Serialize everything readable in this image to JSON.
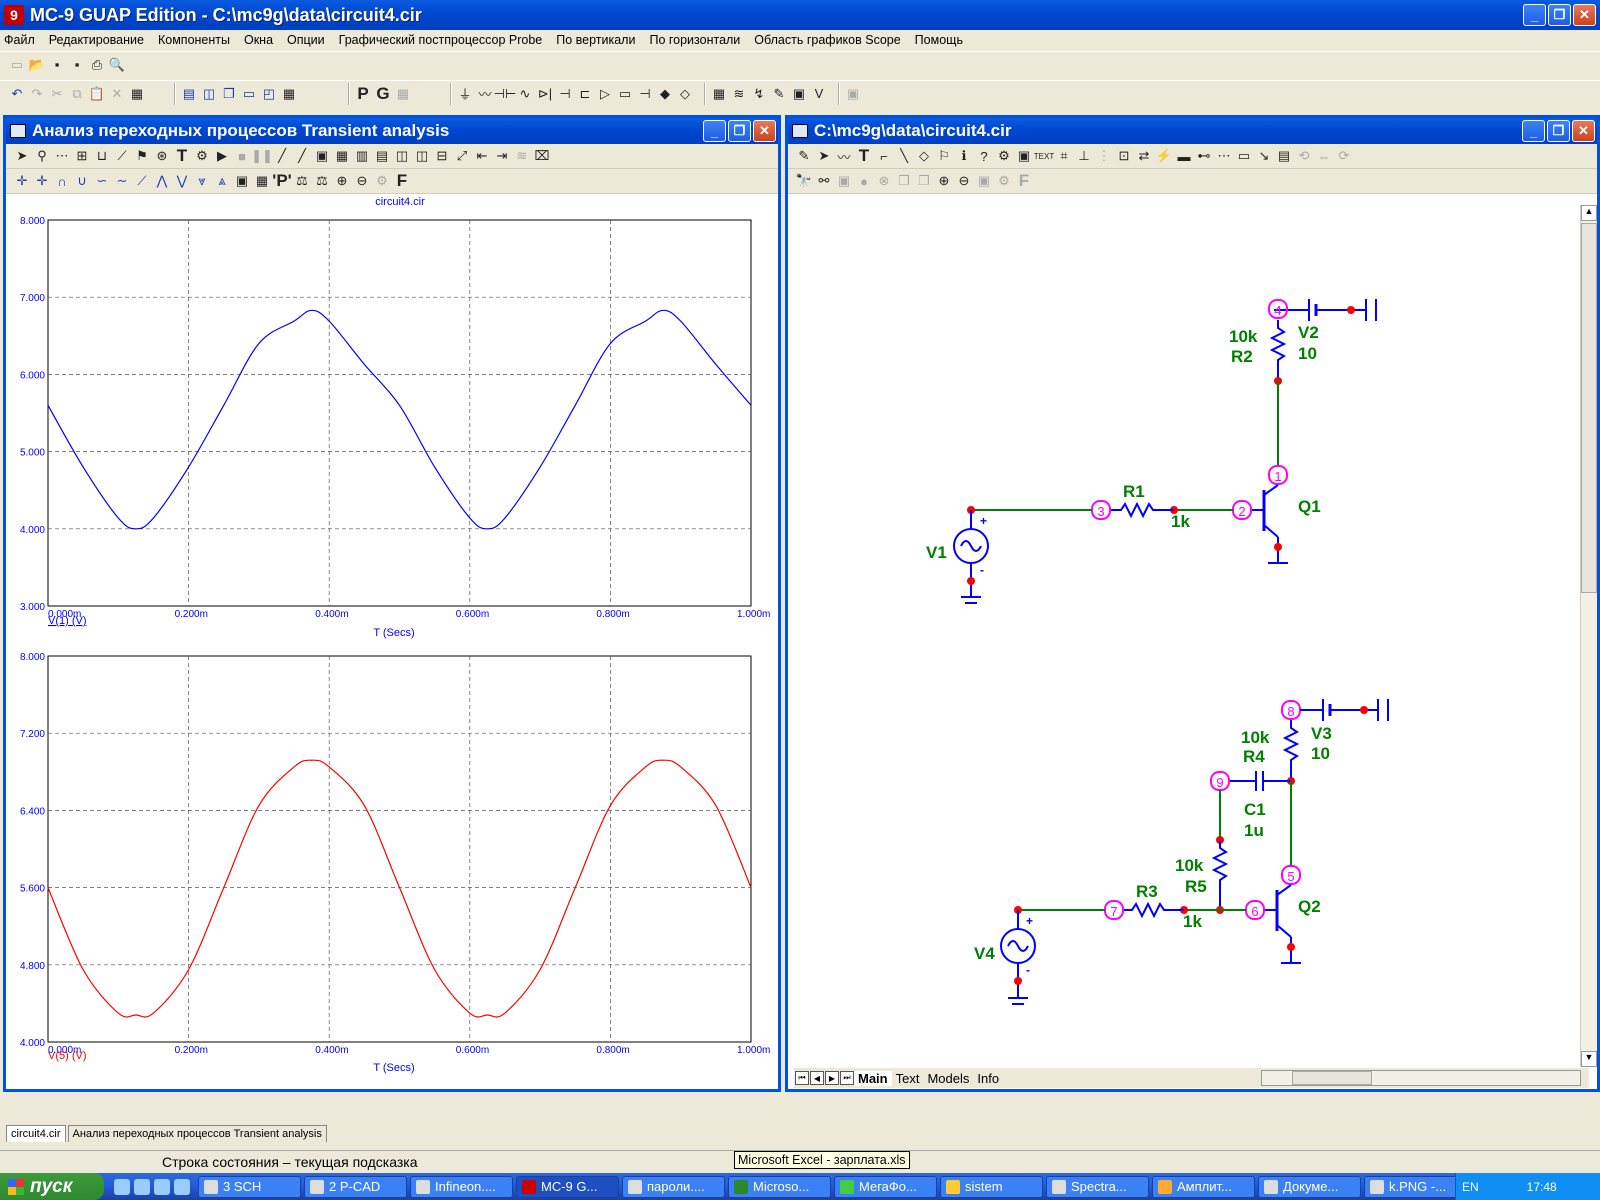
{
  "window": {
    "title": "MC-9 GUAP Edition - C:\\mc9g\\data\\circuit4.cir",
    "app_icon_glyph": "9",
    "minimize": "_",
    "maximize": "❐",
    "close": "✕"
  },
  "menu": [
    "Файл",
    "Редактирование",
    "Компоненты",
    "Окна",
    "Опции",
    "Графический постпроцессор Probe",
    "По вертикали",
    "По горизонтали",
    "Область графиков Scope",
    "Помощь"
  ],
  "transient_window": {
    "title": "Анализ переходных процессов Transient analysis"
  },
  "plot1": {
    "title": "circuit4.cir",
    "trace_label": "V(1) (V)",
    "x_axis_title": "T (Secs)",
    "color": "#0000ff"
  },
  "plot2": {
    "trace_label": "V(5) (V)",
    "x_axis_title": "T (Secs)",
    "color": "#ff0000"
  },
  "chart_data": [
    {
      "type": "line",
      "title": "circuit4.cir",
      "xlabel": "T (Secs)",
      "ylabel": "",
      "xlim": [
        0,
        1.0
      ],
      "ylim": [
        3.0,
        8.0
      ],
      "x_ticks": [
        "0.000m",
        "0.200m",
        "0.400m",
        "0.600m",
        "0.800m",
        "1.000m"
      ],
      "y_ticks": [
        "3.000",
        "4.000",
        "5.000",
        "6.000",
        "7.000",
        "8.000"
      ],
      "grid": true,
      "series": [
        {
          "name": "V(1) (V)",
          "color": "#0000ff",
          "x": [
            0,
            0.05,
            0.1,
            0.125,
            0.15,
            0.2,
            0.25,
            0.3,
            0.35,
            0.375,
            0.4,
            0.45,
            0.5,
            0.55,
            0.6,
            0.625,
            0.65,
            0.7,
            0.75,
            0.8,
            0.85,
            0.875,
            0.9,
            0.95,
            1.0
          ],
          "y": [
            5.6,
            4.8,
            4.14,
            4.0,
            4.14,
            4.8,
            5.6,
            6.4,
            6.69,
            6.83,
            6.69,
            6.13,
            5.6,
            4.8,
            4.14,
            4.0,
            4.14,
            4.8,
            5.6,
            6.4,
            6.69,
            6.83,
            6.69,
            6.13,
            5.6
          ]
        }
      ]
    },
    {
      "type": "line",
      "title": "",
      "xlabel": "T (Secs)",
      "ylabel": "",
      "xlim": [
        0,
        1.0
      ],
      "ylim": [
        4.0,
        8.0
      ],
      "x_ticks": [
        "0.000m",
        "0.200m",
        "0.400m",
        "0.600m",
        "0.800m",
        "1.000m"
      ],
      "y_ticks": [
        "4.000",
        "4.800",
        "5.600",
        "6.400",
        "7.200",
        "8.000"
      ],
      "grid": true,
      "series": [
        {
          "name": "V(5) (V)",
          "color": "#ff0000",
          "x": [
            0,
            0.05,
            0.1,
            0.125,
            0.15,
            0.2,
            0.25,
            0.3,
            0.35,
            0.375,
            0.4,
            0.45,
            0.5,
            0.55,
            0.6,
            0.625,
            0.65,
            0.7,
            0.75,
            0.8,
            0.85,
            0.875,
            0.9,
            0.95,
            1.0
          ],
          "y": [
            5.6,
            4.75,
            4.3,
            4.28,
            4.3,
            4.75,
            5.6,
            6.45,
            6.85,
            6.92,
            6.85,
            6.45,
            5.6,
            4.75,
            4.3,
            4.28,
            4.3,
            4.75,
            5.6,
            6.45,
            6.85,
            6.92,
            6.85,
            6.45,
            5.6
          ]
        }
      ]
    }
  ],
  "schematic_window": {
    "title": "C:\\mc9g\\data\\circuit4.cir"
  },
  "schematic": {
    "nodes": [
      "1",
      "2",
      "3",
      "4",
      "5",
      "6",
      "7",
      "8",
      "9"
    ],
    "components": {
      "R1_name": "R1",
      "R1_value": "1k",
      "R2_name": "R2",
      "R2_value": "10k",
      "R3_name": "R3",
      "R3_value": "1k",
      "R4_name": "R4",
      "R4_value": "10k",
      "R5_name": "R5",
      "R5_value": "10k",
      "C1_name": "C1",
      "C1_value": "1u",
      "V1_name": "V1",
      "V2_name": "V2",
      "V2_value": "10",
      "V3_name": "V3",
      "V3_value": "10",
      "V4_name": "V4",
      "Q1_name": "Q1",
      "Q2_name": "Q2",
      "plus": "+",
      "minus": "-"
    },
    "tabs": [
      "Main",
      "Text",
      "Models",
      "Info"
    ]
  },
  "doc_tabs": [
    "circuit4.cir",
    "Анализ переходных процессов Transient analysis"
  ],
  "status": {
    "text": "Строка состояния – текущая подсказка",
    "tooltip": "Microsoft Excel - зарплата.xls"
  },
  "taskbar": {
    "start_label": "пуск",
    "tasks": [
      "3 SCH",
      "2 P-CAD",
      "Infineon....",
      "MC-9 G...",
      "пароли....",
      "Microso...",
      "МегаФо...",
      "sistem",
      "Spectra...",
      "Амплит...",
      "Докуме...",
      "k.PNG -..."
    ],
    "lang": "EN",
    "clock": "17:48"
  },
  "toolbar_glyphs": {
    "p_button": "P",
    "g_button": "G",
    "p_prime": "'P'",
    "f_button": "F",
    "t_button": "T",
    "text_button": "TEXT"
  }
}
